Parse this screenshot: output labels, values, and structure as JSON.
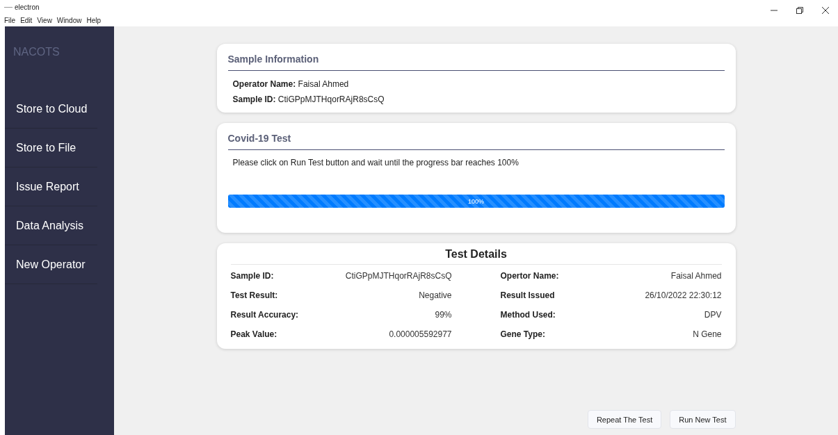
{
  "window": {
    "title": "electron"
  },
  "menu": [
    "File",
    "Edit",
    "View",
    "Window",
    "Help"
  ],
  "sidebar": {
    "brand": "NACOTS",
    "items": [
      {
        "label": "Store to Cloud"
      },
      {
        "label": "Store to File"
      },
      {
        "label": "Issue Report"
      },
      {
        "label": "Data Analysis"
      },
      {
        "label": "New Operator"
      }
    ]
  },
  "sample_info": {
    "title": "Sample Information",
    "fields": [
      {
        "label": "Operator Name:",
        "value": "Faisal Ahmed"
      },
      {
        "label": "Sample ID:",
        "value": "CtiGPpMJTHqorRAjR8sCsQ"
      }
    ]
  },
  "test": {
    "title": "Covid-19 Test",
    "instruction": "Please click on Run Test button and wait until the progress bar reaches 100%",
    "progress": {
      "level": 1,
      "reading": "100%"
    }
  },
  "details": {
    "title": "Test Details",
    "rows": [
      {
        "label": "Sample ID:",
        "value": "CtiGPpMJTHqorRAjR8sCsQ",
        "label2": "Opertor Name:",
        "value2": "Faisal Ahmed"
      },
      {
        "label": "Test Result:",
        "value": "Negative",
        "label2": "Result Issued",
        "value2": "26/10/2022 22:30:12"
      },
      {
        "label": "Result Accuracy:",
        "value": "99%",
        "label2": "Method Used:",
        "value2": "DPV"
      },
      {
        "label": "Peak Value:",
        "value": "0.000005592977",
        "label2": "Gene Type:",
        "value2": "N Gene"
      }
    ]
  },
  "buttons": [
    "Repeat The Test",
    "Run New Test"
  ]
}
